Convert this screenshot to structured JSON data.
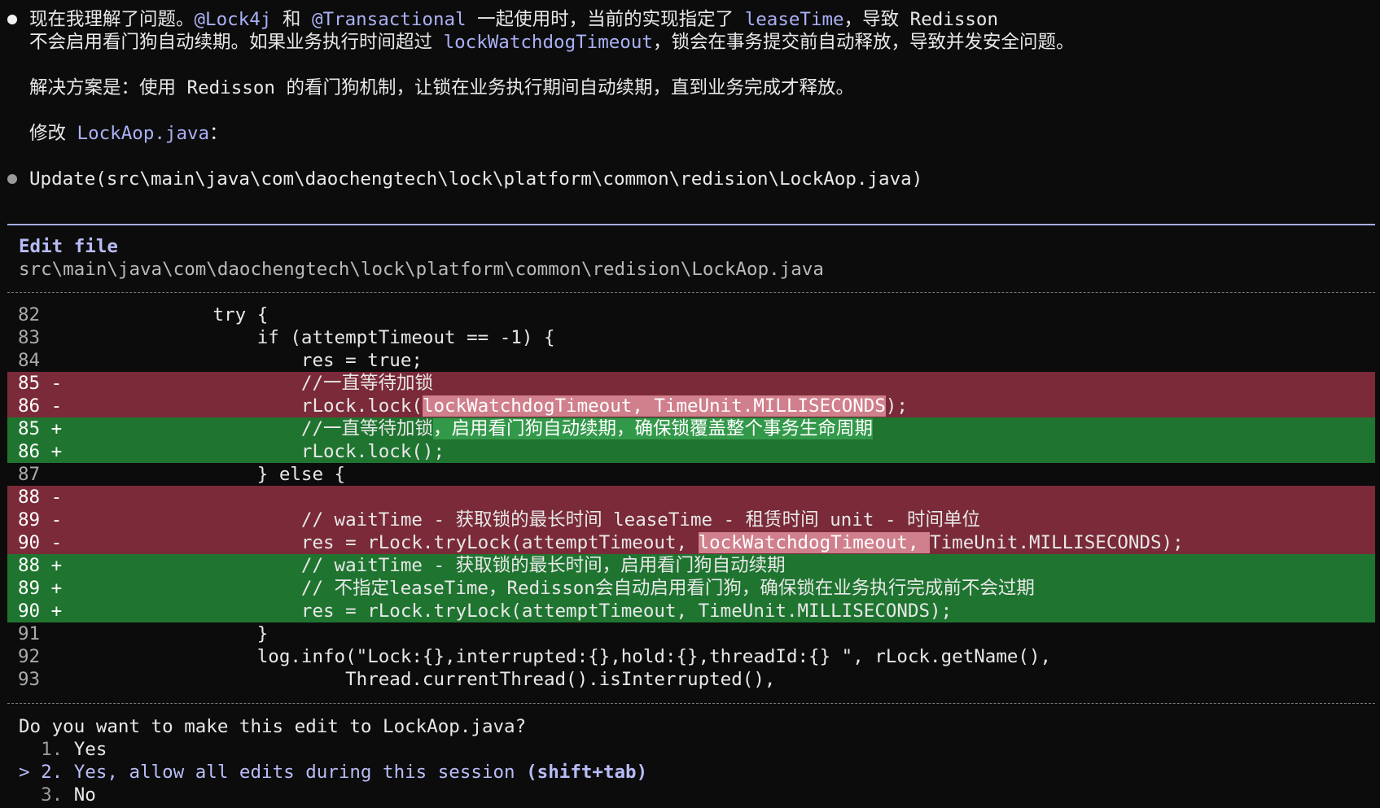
{
  "message": {
    "p1_a": "现在我理解了问题。",
    "p1_code1": "@Lock4j",
    "p1_b": " 和 ",
    "p1_code2": "@Transactional",
    "p1_c": " 一起使用时，当前的实现指定了 ",
    "p1_code3": "leaseTime",
    "p1_d": "，导致 Redisson",
    "p2_a": "不会启用看门狗自动续期。如果业务执行时间超过 ",
    "p2_code": "lockWatchdogTimeout",
    "p2_b": "，锁会在事务提交前自动释放，导致并发安全问题。",
    "solution": "解决方案是：使用 Redisson 的看门狗机制，让锁在业务执行期间自动续期，直到业务完成才释放。",
    "modify_a": "修改 ",
    "modify_file": "LockAop.java",
    "modify_b": "："
  },
  "tool_call": "Update(src\\main\\java\\com\\daochengtech\\lock\\platform\\common\\redision\\LockAop.java)",
  "edit": {
    "title": "Edit file",
    "path": "src\\main\\java\\com\\daochengtech\\lock\\platform\\common\\redision\\LockAop.java",
    "lines": [
      {
        "num": "82",
        "type": "ctx",
        "code": "            try {"
      },
      {
        "num": "83",
        "type": "ctx",
        "code": "                if (attemptTimeout == -1) {"
      },
      {
        "num": "84",
        "type": "ctx",
        "code": "                    res = true;"
      },
      {
        "num": "85 -",
        "type": "del",
        "code": "                    //一直等待加锁"
      },
      {
        "num": "86 -",
        "type": "del",
        "pre": "                    rLock.lock(",
        "hl": "lockWatchdogTimeout, TimeUnit.MILLISECONDS",
        "post": ");"
      },
      {
        "num": "85 +",
        "type": "add",
        "pre": "                    //一直等待加锁",
        "hl": "，启用看门狗自动续期，确保锁覆盖整个事务生命周期",
        "post": ""
      },
      {
        "num": "86 +",
        "type": "add",
        "code": "                    rLock.lock();"
      },
      {
        "num": "87",
        "type": "ctx",
        "code": "                } else {"
      },
      {
        "num": "88 -",
        "type": "del",
        "code": ""
      },
      {
        "num": "89 -",
        "type": "del",
        "code": "                    // waitTime - 获取锁的最长时间 leaseTime - 租赁时间 unit - 时间单位"
      },
      {
        "num": "90 -",
        "type": "del",
        "pre": "                    res = rLock.tryLock(attemptTimeout, ",
        "hl": "lockWatchdogTimeout, ",
        "post": "TimeUnit.MILLISECONDS);"
      },
      {
        "num": "88 +",
        "type": "add",
        "code": "                    // waitTime - 获取锁的最长时间，启用看门狗自动续期"
      },
      {
        "num": "89 +",
        "type": "add",
        "code": "                    // 不指定leaseTime，Redisson会自动启用看门狗，确保锁在业务执行完成前不会过期"
      },
      {
        "num": "90 +",
        "type": "add",
        "code": "                    res = rLock.tryLock(attemptTimeout, TimeUnit.MILLISECONDS);"
      },
      {
        "num": "91",
        "type": "ctx",
        "code": "                }"
      },
      {
        "num": "92",
        "type": "ctx",
        "code": "                log.info(\"Lock:{},interrupted:{},hold:{},threadId:{} \", rLock.getName(),"
      },
      {
        "num": "93",
        "type": "ctx",
        "code": "                        Thread.currentThread().isInterrupted(),"
      }
    ]
  },
  "prompt": {
    "question": "Do you want to make this edit to LockAop.java?",
    "options": [
      {
        "marker": "  ",
        "num": "1.",
        "label": "Yes",
        "hint": "",
        "selected": false
      },
      {
        "marker": "> ",
        "num": "2.",
        "label": "Yes, allow all edits during this session",
        "hint": "(shift+tab)",
        "selected": true
      },
      {
        "marker": "  ",
        "num": "3.",
        "label": "No",
        "hint": "",
        "selected": false
      }
    ]
  }
}
